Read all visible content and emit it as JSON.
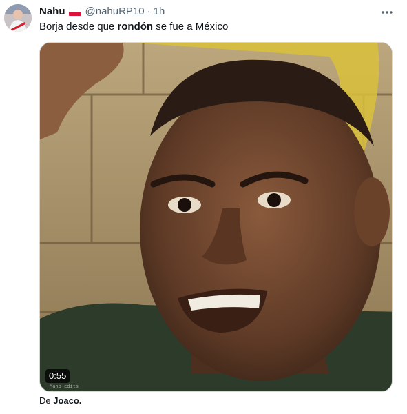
{
  "tweet": {
    "display_name": "Nahu",
    "handle": "@nahuRP10",
    "separator": "·",
    "timestamp": "1h",
    "text_before": "Borja desde que ",
    "text_bold": "rondón",
    "text_after": " se fue a México",
    "media": {
      "type": "video",
      "duration": "0:55",
      "watermark": "Mano-edits"
    },
    "attribution": {
      "prefix": "De ",
      "author": "Joaco."
    }
  },
  "icons": {
    "flag": "poland-flag-icon",
    "more": "more-horizontal-icon",
    "avatar": "user-avatar"
  },
  "colors": {
    "text_primary": "#0f1419",
    "text_secondary": "#536471",
    "border": "#cfd9de",
    "flag_top": "#ffffff",
    "flag_bottom": "#dc143c"
  }
}
